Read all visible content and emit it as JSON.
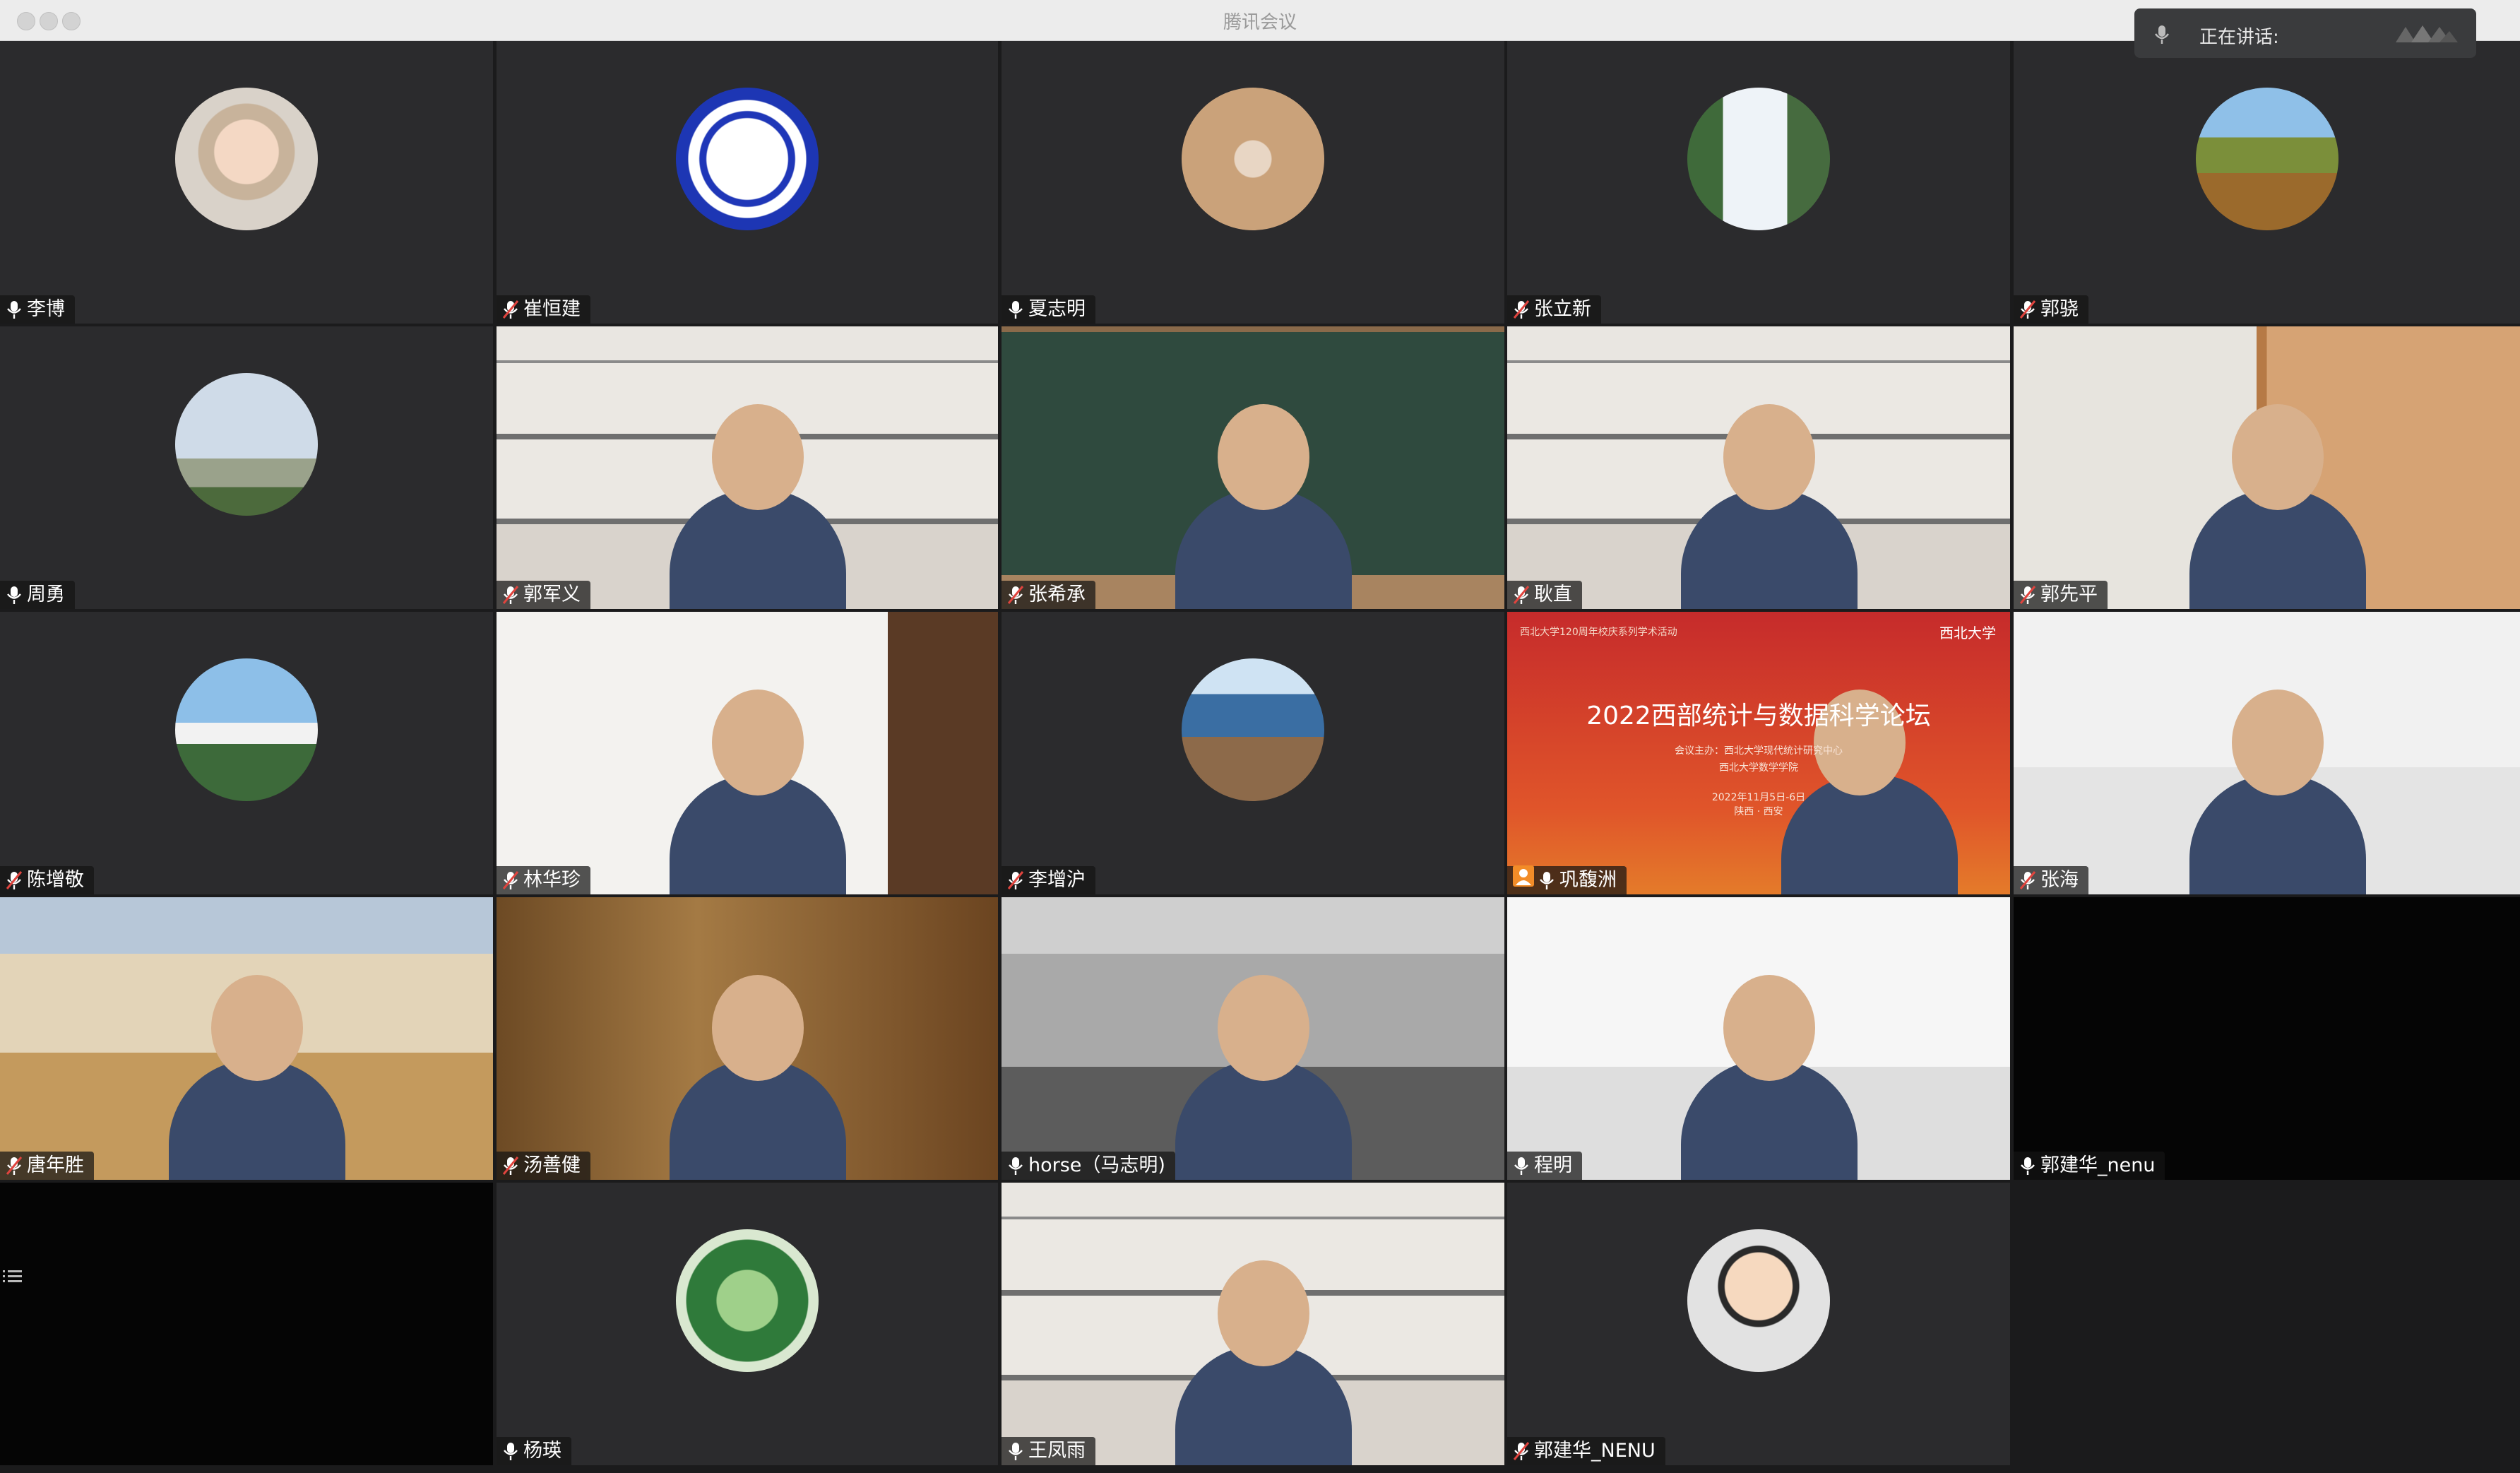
{
  "window": {
    "title": "腾讯会议"
  },
  "speaking": {
    "label": "正在讲话:"
  },
  "colors": {
    "tile_bg": "#2b2b2d",
    "muted_mic": "#e0443e",
    "active_mic": "#ffffff"
  },
  "tiles": [
    {
      "name": "李博",
      "mic": "on",
      "kind": "avatar",
      "icon": "cartoon-baby-avatar"
    },
    {
      "name": "崔恒建",
      "mic": "muted",
      "kind": "avatar",
      "icon": "logo-avatar"
    },
    {
      "name": "夏志明",
      "mic": "on",
      "kind": "avatar",
      "icon": "child-photo-avatar"
    },
    {
      "name": "张立新",
      "mic": "muted",
      "kind": "avatar",
      "icon": "waterfall-avatar"
    },
    {
      "name": "郭骁",
      "mic": "muted",
      "kind": "avatar",
      "icon": "flower-field-avatar"
    },
    {
      "name": "周勇",
      "mic": "on",
      "kind": "avatar",
      "icon": "towers-avatar"
    },
    {
      "name": "郭军义",
      "mic": "muted",
      "kind": "video",
      "icon": "bookshelf-background"
    },
    {
      "name": "张希承",
      "mic": "muted",
      "kind": "video",
      "icon": "chalkboard-background"
    },
    {
      "name": "耿直",
      "mic": "muted",
      "kind": "video",
      "icon": "bookshelf-background"
    },
    {
      "name": "郭先平",
      "mic": "muted",
      "kind": "video",
      "icon": "library-background"
    },
    {
      "name": "陈增敬",
      "mic": "muted",
      "kind": "avatar",
      "icon": "island-avatar"
    },
    {
      "name": "林华珍",
      "mic": "muted",
      "kind": "video",
      "icon": "office-background"
    },
    {
      "name": "李增沪",
      "mic": "muted",
      "kind": "avatar",
      "icon": "seaside-coffee-avatar"
    },
    {
      "name": "巩馥洲",
      "mic": "on",
      "kind": "video",
      "icon": "forum-slide-background",
      "host": true
    },
    {
      "name": "张海",
      "mic": "muted",
      "kind": "video",
      "icon": "meeting-room-background"
    },
    {
      "name": "唐年胜",
      "mic": "muted",
      "kind": "video",
      "icon": "classroom-background"
    },
    {
      "name": "汤善健",
      "mic": "muted",
      "kind": "video",
      "icon": "wood-door-background"
    },
    {
      "name": "horse（马志明)",
      "mic": "on",
      "kind": "video",
      "icon": "campus-background"
    },
    {
      "name": "程明",
      "mic": "on",
      "kind": "video",
      "icon": "loft-background"
    },
    {
      "name": "郭建华_nenu",
      "mic": "on",
      "kind": "dark",
      "icon": ""
    },
    {
      "name": "",
      "mic": "",
      "kind": "dark",
      "icon": ""
    },
    {
      "name": "杨瑛",
      "mic": "on",
      "kind": "avatar",
      "icon": "grass-avatar"
    },
    {
      "name": "王凤雨",
      "mic": "on",
      "kind": "video",
      "icon": "bookshelf-background"
    },
    {
      "name": "郭建华_NENU",
      "mic": "muted",
      "kind": "avatar",
      "icon": "cartoon-man-avatar"
    }
  ],
  "forum_slide": {
    "title": "2022西部统计与数据科学论坛",
    "header": "西北大学120周年校庆系列学术活动",
    "organizer_1": "会议主办：西北大学现代统计研究中心",
    "organizer_2": "西北大学数学学院",
    "date": "2022年11月5日-6日",
    "place": "陕西 · 西安",
    "logo": "西北大学"
  }
}
